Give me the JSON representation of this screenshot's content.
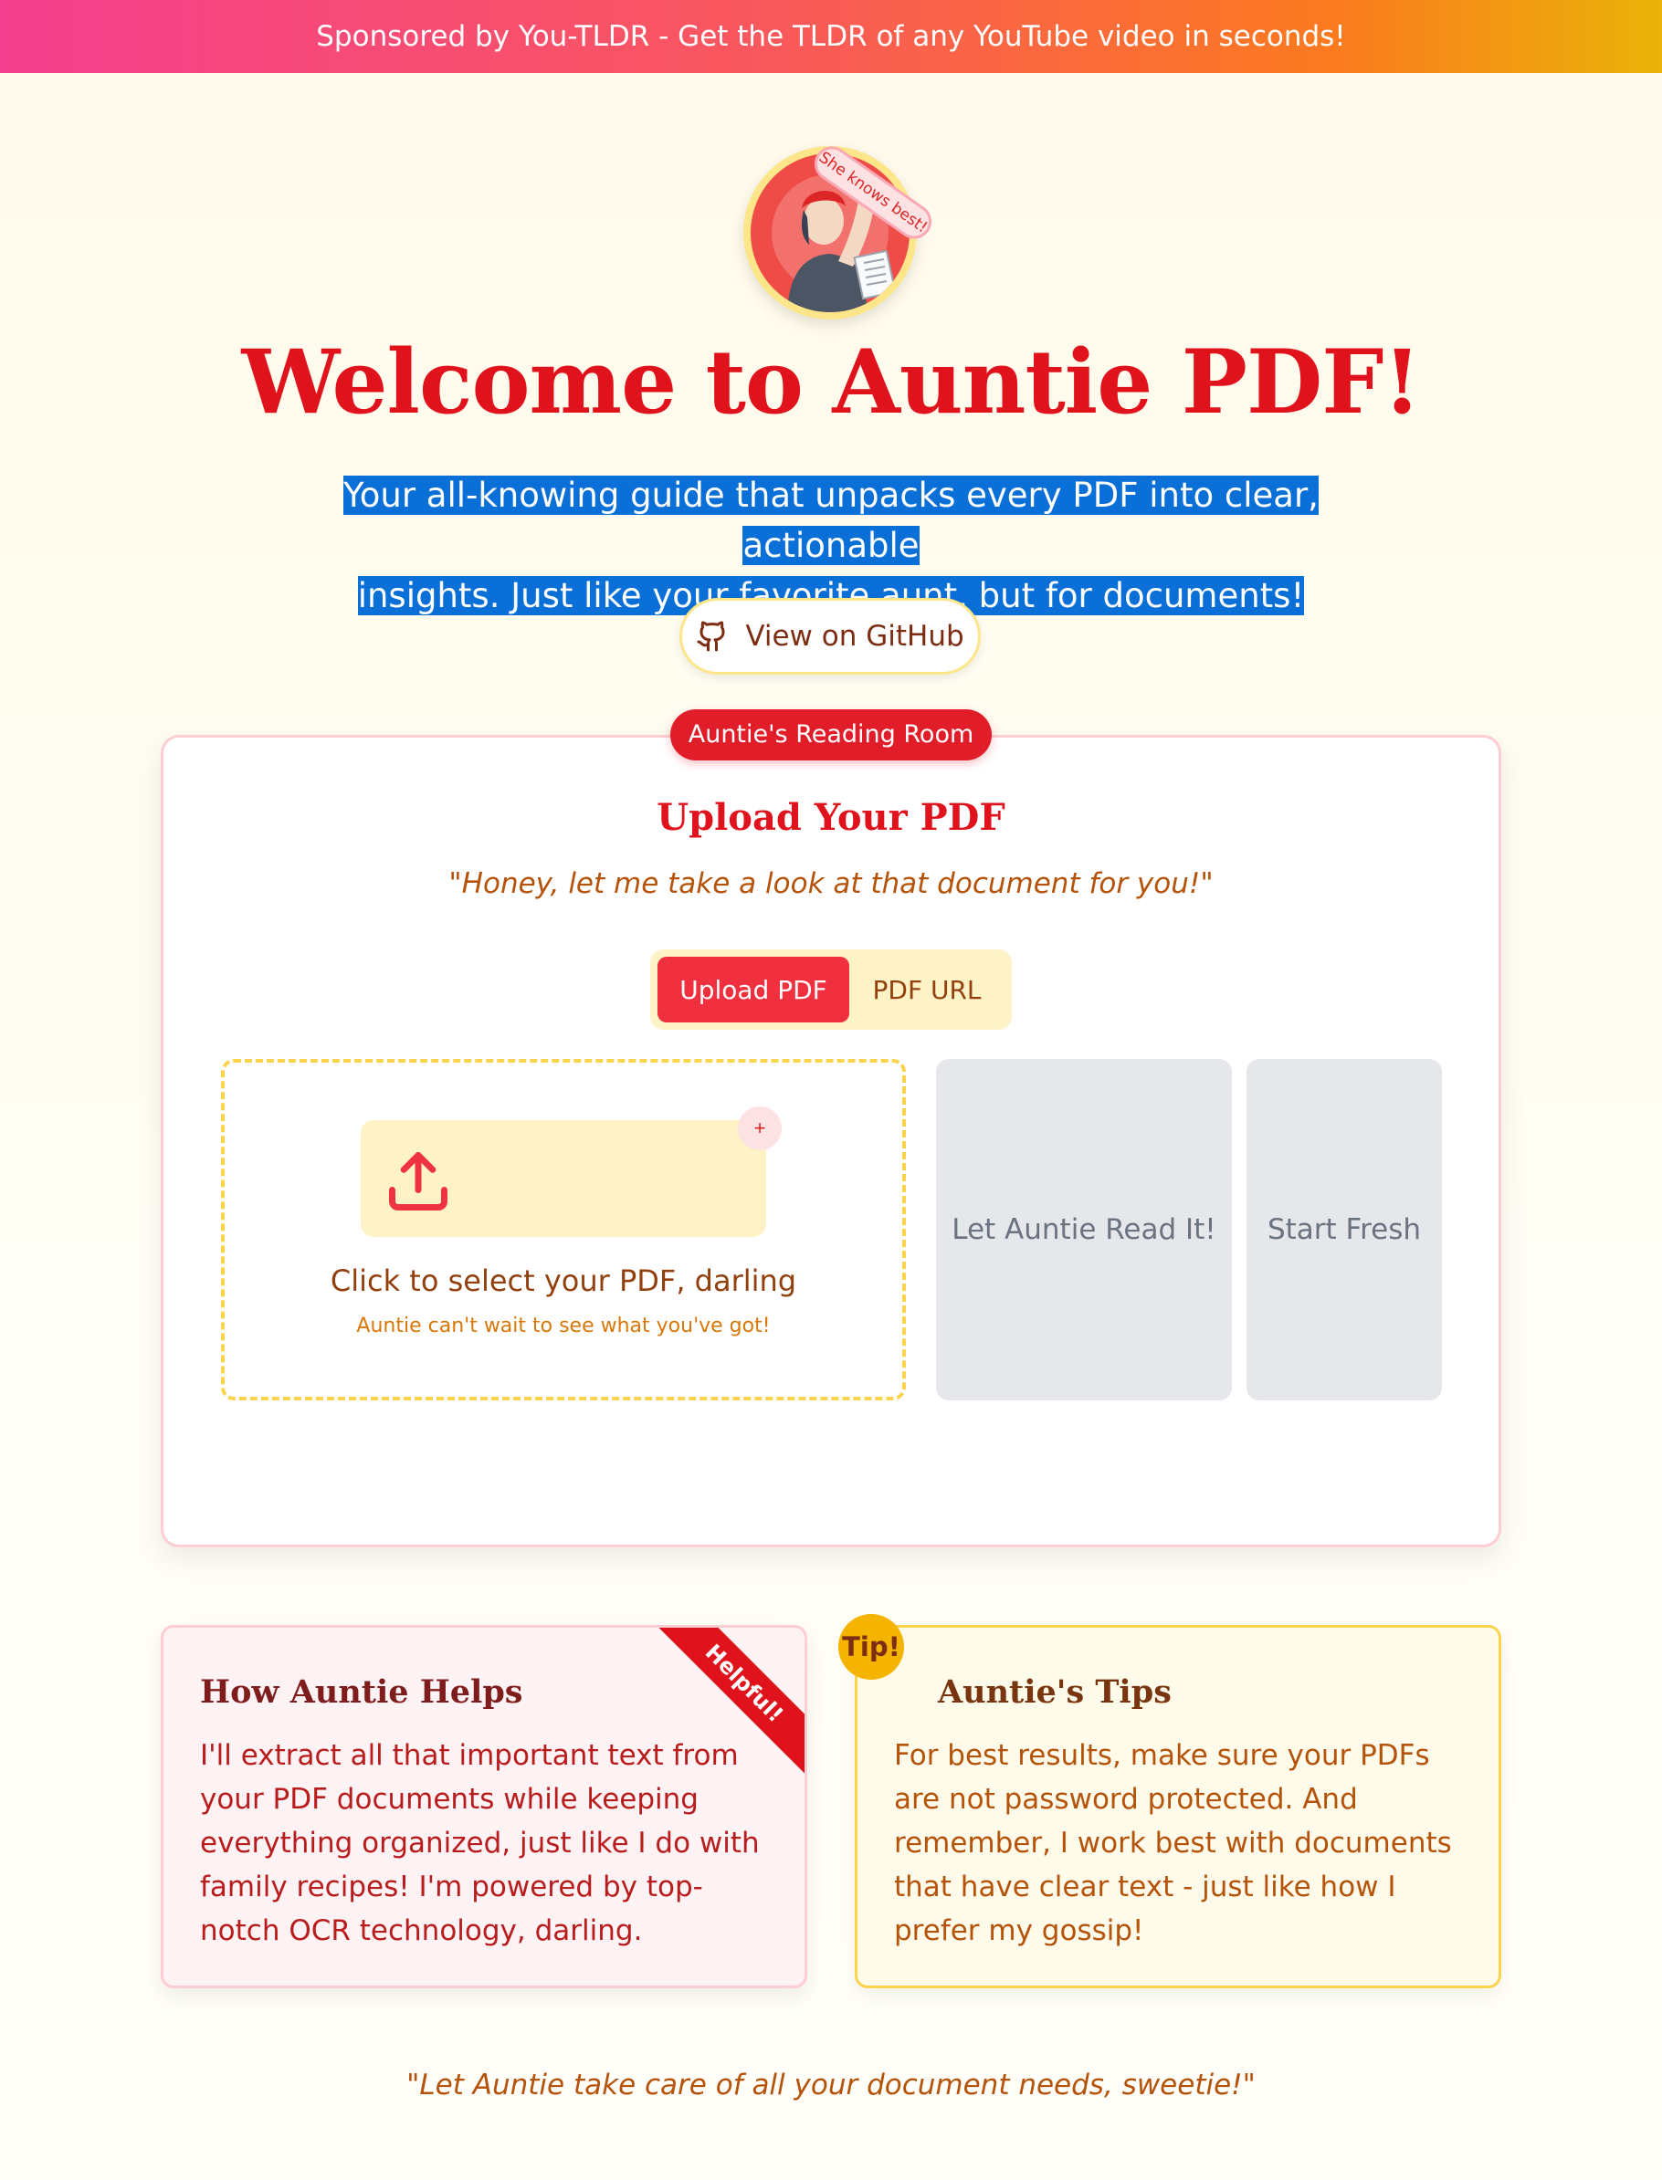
{
  "banner": {
    "text": "Sponsored by You-TLDR - Get the TLDR of any YouTube video in seconds!"
  },
  "hero": {
    "sticker": "She knows best!",
    "title": "Welcome to Auntie PDF!",
    "subtitle_line1": "Your all-knowing guide that unpacks every PDF into clear, actionable",
    "subtitle_line2": "insights. Just like your favorite aunt, but for documents!",
    "github_label": "View on GitHub",
    "github_icon": "github-icon"
  },
  "reading_room": {
    "tag": "Auntie's Reading Room",
    "title": "Upload Your PDF",
    "quote": "\"Honey, let me take a look at that document for you!\"",
    "tabs": [
      {
        "label": "Upload PDF",
        "active": true
      },
      {
        "label": "PDF URL",
        "active": false
      }
    ],
    "dropzone": {
      "icon": "upload-icon",
      "badge": "+",
      "main_text": "Click to select your PDF, darling",
      "sub_text": "Auntie can't wait to see what you've got!"
    },
    "read_button": "Let Auntie Read It!",
    "reset_button": "Start Fresh"
  },
  "how_card": {
    "title": "How Auntie Helps",
    "ribbon": "Helpful!",
    "text": "I'll extract all that important text from your PDF documents while keeping everything organized, just like I do with family recipes! I'm powered by top-notch OCR technology, darling."
  },
  "tips_card": {
    "badge": "Tip!",
    "title": "Auntie's Tips",
    "text": "For best results, make sure your PDFs are not password protected. And remember, I work best with documents that have clear text - just like how I prefer my gossip!"
  },
  "footer": {
    "quote": "\"Let Auntie take care of all your document needs, sweetie!\""
  },
  "colors": {
    "accent_red": "#e0121c",
    "tab_active": "#f0303e",
    "cream": "#fef3c7",
    "selection_blue": "#0a6fd6"
  }
}
